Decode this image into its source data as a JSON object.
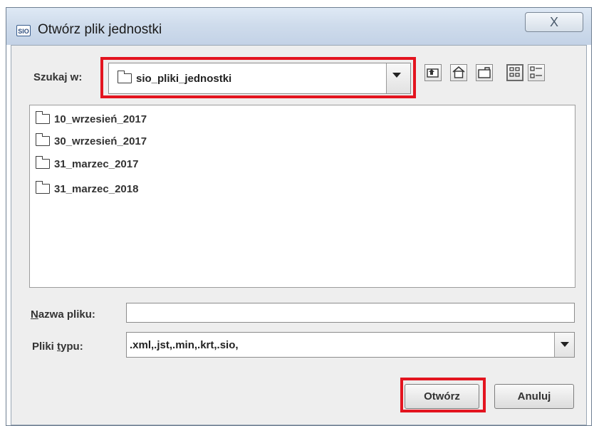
{
  "window": {
    "title": "Otwórz plik jednostki",
    "app_icon_text": "SIO",
    "close_symbol": "X"
  },
  "look_in": {
    "label": "Szukaj w:",
    "value": "sio_pliki_jednostki"
  },
  "toolbar": {
    "buttons": [
      "up-folder-icon",
      "home-icon",
      "new-folder-icon",
      "list-view-icon",
      "details-view-icon"
    ]
  },
  "files": [
    "10_wrzesień_2017",
    "30_wrzesień_2017",
    "31_marzec_2017",
    "31_marzec_2018"
  ],
  "file_name": {
    "label_first": "N",
    "label_rest": "azwa pliku:",
    "value": ""
  },
  "file_type": {
    "label_pre": "Pliki ",
    "label_u": "t",
    "label_post": "ypu:",
    "value": ".xml,.jst,.min,.krt,.sio,"
  },
  "buttons": {
    "open": "Otwórz",
    "cancel": "Anuluj"
  },
  "colors": {
    "highlight": "#e3141f",
    "titlebar": "#cfdcec",
    "panel": "#eeeeee"
  }
}
